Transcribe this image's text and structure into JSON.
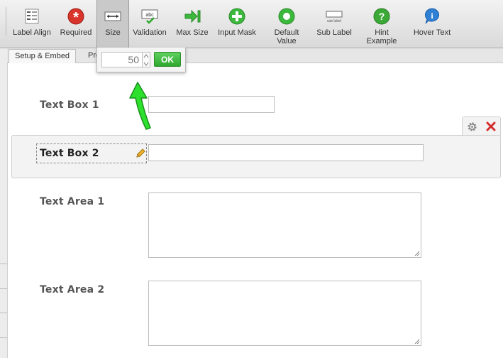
{
  "toolbar": {
    "items": [
      {
        "label": "Label Align",
        "icon": "label-align-icon"
      },
      {
        "label": "Required",
        "icon": "required-icon"
      },
      {
        "label": "Size",
        "icon": "size-icon",
        "active": true
      },
      {
        "label": "Validation",
        "icon": "validation-icon"
      },
      {
        "label": "Max Size",
        "icon": "max-size-icon"
      },
      {
        "label": "Input Mask",
        "icon": "input-mask-icon"
      },
      {
        "label_line1": "Default",
        "label_line2": "Value",
        "icon": "default-value-icon"
      },
      {
        "label": "Sub Label",
        "icon": "sub-label-icon",
        "icon_text": "sub label"
      },
      {
        "label_line1": "Hint",
        "label_line2": "Example",
        "icon": "hint-icon"
      },
      {
        "label": "Hover Text",
        "icon": "hover-text-icon"
      }
    ],
    "validation_icon_text": "abc"
  },
  "tabs": [
    {
      "label": "Setup & Embed"
    },
    {
      "label": "Pro"
    }
  ],
  "size_popup": {
    "value": "50",
    "ok_label": "OK"
  },
  "form": {
    "fields": [
      {
        "label": "Text Box 1",
        "type": "textbox"
      },
      {
        "label": "Text Box 2",
        "type": "textbox",
        "selected": true
      },
      {
        "label": "Text Area 1",
        "type": "textarea"
      },
      {
        "label": "Text Area 2",
        "type": "textarea"
      }
    ]
  },
  "colors": {
    "accent_green": "#3cb83c",
    "required_red": "#d9342b",
    "hint_green": "#3aa935",
    "hover_blue": "#2f7fd4",
    "delete_red": "#d42d2d"
  }
}
